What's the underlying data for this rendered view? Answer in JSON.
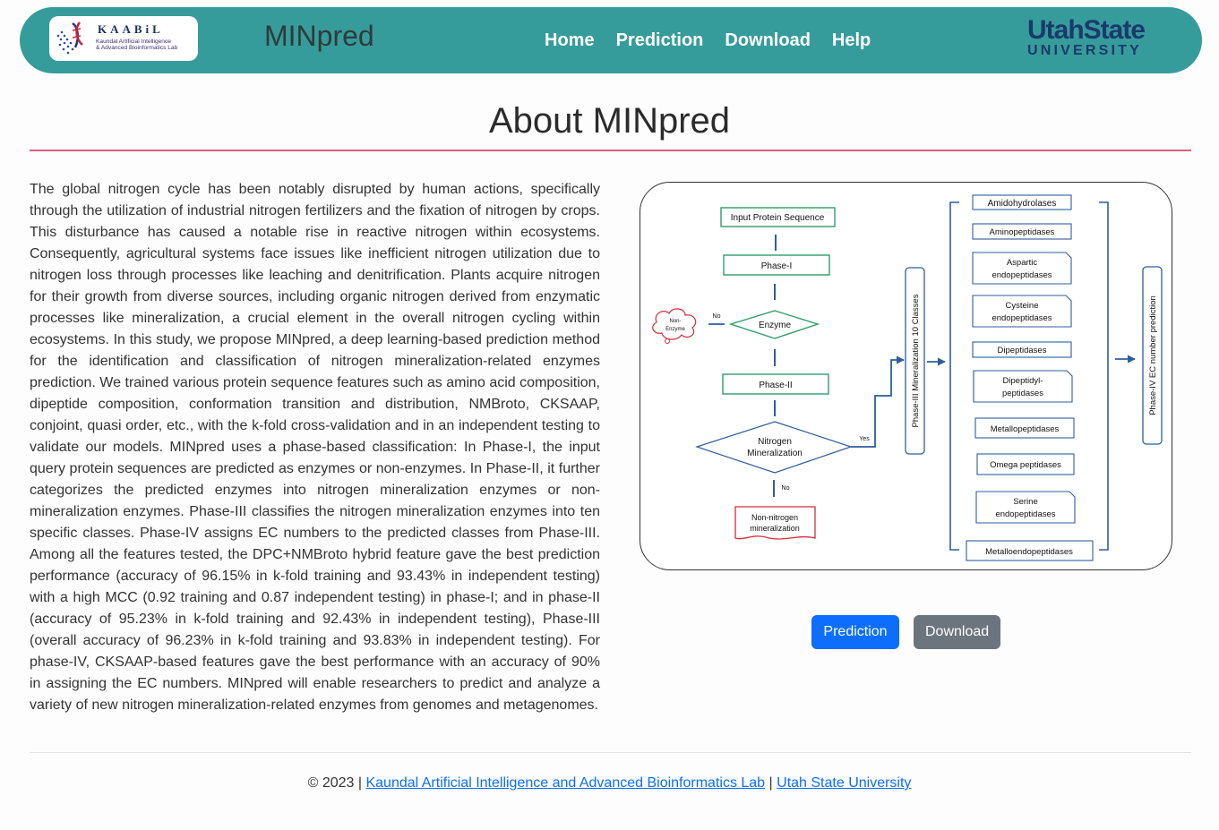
{
  "nav": {
    "logo_title": "KAABiL",
    "logo_sub_1": "Kaundal Artificial Intelligence",
    "logo_sub_2": "& Advanced Bioinformatics Lab",
    "brand": "MINpred",
    "links": [
      "Home",
      "Prediction",
      "Download",
      "Help"
    ],
    "usu_top": "UtahState",
    "usu_bottom": "UNIVERSITY"
  },
  "page": {
    "title": "About MINpred",
    "about": "The global nitrogen cycle has been notably disrupted by human actions, specifically through the utilization of industrial nitrogen fertilizers and the fixation of nitrogen by crops. This disturbance has caused a notable rise in reactive nitrogen within ecosystems. Consequently, agricultural systems face issues like inefficient nitrogen utilization due to nitrogen loss through processes like leaching and denitrification. Plants acquire nitrogen for their growth from diverse sources, including organic nitrogen derived from enzymatic processes like mineralization, a crucial element in the overall nitrogen cycling within ecosystems. In this study, we propose MINpred, a deep learning-based prediction method for the identification and classification of nitrogen mineralization-related enzymes prediction. We trained various protein sequence features such as amino acid composition, dipeptide composition, conformation transition and distribution, NMBroto, CKSAAP, conjoint, quasi order, etc., with the k-fold cross-validation and in an independent testing to validate our models. MINpred uses a phase-based classification: In Phase-I, the input query protein sequences are predicted as enzymes or non-enzymes. In Phase-II, it further categorizes the predicted enzymes into nitrogen mineralization enzymes or non-mineralization enzymes. Phase-III classifies the nitrogen mineralization enzymes into ten specific classes. Phase-IV assigns EC numbers to the predicted classes from Phase-III. Among all the features tested, the DPC+NMBroto hybrid feature gave the best prediction performance (accuracy of 96.15% in k-fold training and 93.43% in independent testing) with a high MCC (0.92 training and 0.87 independent testing) in phase-I; and in phase-II (accuracy of 95.23% in k-fold training and 92.43% in independent testing), Phase-III (overall accuracy of 96.23% in k-fold training and 93.83% in independent testing). For phase-IV, CKSAAP-based features gave the best performance with an accuracy of 90% in assigning the EC numbers. MINpred will enable researchers to predict and analyze a variety of new nitrogen mineralization-related enzymes from genomes and metagenomes."
  },
  "diagram": {
    "input": "Input Protein Sequence",
    "phase1": "Phase-I",
    "enzyme": "Enzyme",
    "non_enzyme_1": "Non-",
    "non_enzyme_2": "Enzyme",
    "no_1": "No",
    "phase2": "Phase-II",
    "nitrogen_1": "Nitrogen",
    "nitrogen_2": "Mineralization",
    "yes": "Yes",
    "no_2": "No",
    "non_nitrogen_1": "Non-nitrogen",
    "non_nitrogen_2": "mineralization",
    "phase3_label": "Phase-III Mineralization 10 Classes",
    "phase4_label": "Phase-IV EC number prediction",
    "classes": [
      {
        "l1": "Amidohydrolases",
        "l2": ""
      },
      {
        "l1": "Aminopeptidases",
        "l2": ""
      },
      {
        "l1": "Aspartic",
        "l2": "endopeptidases"
      },
      {
        "l1": "Cysteine",
        "l2": "endopeptidases"
      },
      {
        "l1": "Dipeptidases",
        "l2": ""
      },
      {
        "l1": "Dipeptidyl-",
        "l2": "peptidases"
      },
      {
        "l1": "Metallopeptidases",
        "l2": ""
      },
      {
        "l1": "Omega peptidases",
        "l2": ""
      },
      {
        "l1": "Serine",
        "l2": "endopeptidases"
      },
      {
        "l1": "Metalloendopeptidases",
        "l2": ""
      }
    ]
  },
  "buttons": {
    "prediction": "Prediction",
    "download": "Download"
  },
  "footer": {
    "copyright": "© 2023 |",
    "sep": "|",
    "lab_link": "Kaundal Artificial Intelligence and Advanced Bioinformatics Lab",
    "usu_link": "Utah State University"
  },
  "colors": {
    "nav_bg": "#369c9b",
    "title_rule": "#d9647b",
    "flow_green": "#2e9e6a",
    "flow_blue": "#2f5d9c",
    "flow_red": "#d0303a"
  }
}
